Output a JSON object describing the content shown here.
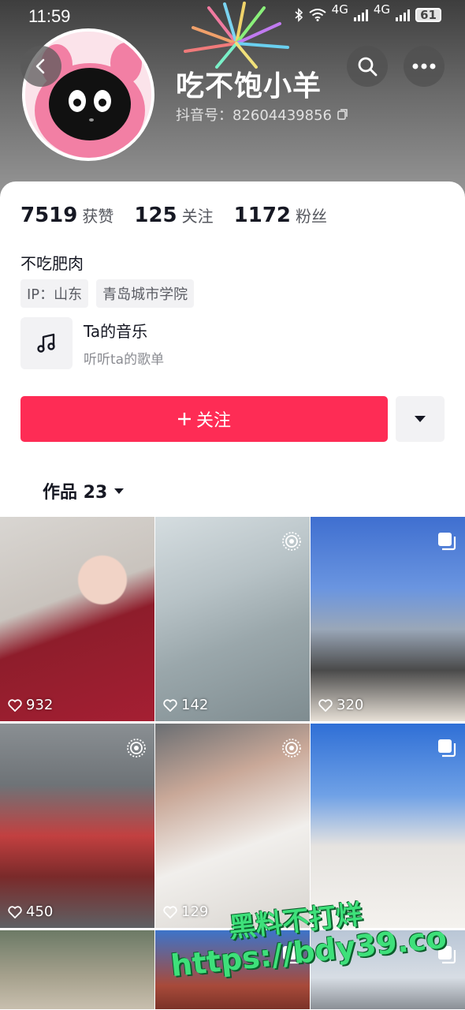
{
  "status_bar": {
    "time": "11:59",
    "network_left": "4G",
    "network_right": "4G",
    "battery": "61"
  },
  "profile": {
    "nickname": "吃不饱小羊",
    "douyin_id": "抖音号：82604439856",
    "stats": [
      {
        "value": "7519",
        "label": "获赞"
      },
      {
        "value": "125",
        "label": "关注"
      },
      {
        "value": "1172",
        "label": "粉丝"
      }
    ],
    "bio": "不吃肥肉",
    "tags": [
      "IP：山东",
      "青岛城市学院"
    ],
    "music": {
      "title": "Ta的音乐",
      "subtitle": "听听ta的歌单"
    }
  },
  "actions": {
    "follow_label": "关注"
  },
  "works_tab": {
    "label": "作品 23"
  },
  "videos": [
    {
      "likes": "932",
      "badge": "none"
    },
    {
      "likes": "142",
      "badge": "live-photo-icon"
    },
    {
      "likes": "320",
      "badge": "gallery-icon"
    },
    {
      "likes": "450",
      "badge": "live-photo-icon"
    },
    {
      "likes": "129",
      "badge": "live-photo-icon"
    },
    {
      "likes": "",
      "badge": "gallery-icon"
    },
    {
      "likes": "",
      "badge": "none"
    },
    {
      "likes": "",
      "badge": "gallery-icon"
    },
    {
      "likes": "",
      "badge": "gallery-icon"
    }
  ],
  "watermark": {
    "line1": "黑料不打烊",
    "line2": "https://bdy39.co"
  },
  "colors": {
    "accent": "#fe2c55",
    "header": "#6a6a6a",
    "watermark": "#3ee07a"
  }
}
